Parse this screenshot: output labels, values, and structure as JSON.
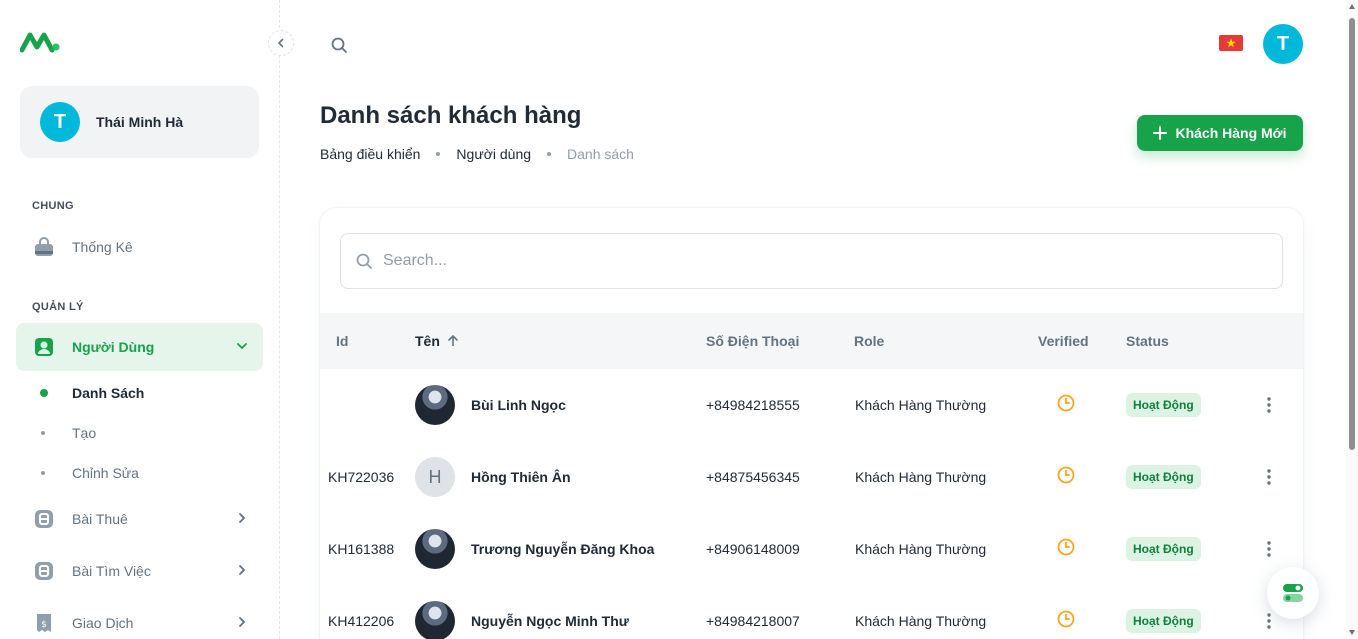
{
  "sidebar": {
    "user_initial": "T",
    "user_name": "Thái Minh Hà",
    "section_general": "CHUNG",
    "section_manage": "QUẢN LÝ",
    "items": [
      {
        "label": "Thống Kê",
        "icon": "bag-icon"
      },
      {
        "label": "Người Dùng",
        "icon": "user-icon"
      },
      {
        "label": "Bài Thuê",
        "icon": "blog-icon"
      },
      {
        "label": "Bài Tìm Việc",
        "icon": "blog-icon"
      },
      {
        "label": "Giao Dịch",
        "icon": "invoice-icon"
      }
    ],
    "sub_items": [
      {
        "label": "Danh Sách"
      },
      {
        "label": "Tạo"
      },
      {
        "label": "Chỉnh Sửa"
      }
    ]
  },
  "header": {
    "avatar_initial": "T",
    "language_flag": "vietnam-flag-icon"
  },
  "page": {
    "title": "Danh sách khách hàng",
    "breadcrumb": [
      "Bảng điều khiển",
      "Người dùng",
      "Danh sách"
    ],
    "new_button": "Khách Hàng Mới"
  },
  "search": {
    "placeholder": "Search..."
  },
  "table": {
    "columns": [
      "Id",
      "Tên",
      "Số Điện Thoại",
      "Role",
      "Verified",
      "Status"
    ],
    "rows": [
      {
        "id": "",
        "avatar": "photo",
        "initial": "",
        "name": "Bùi Linh Ngọc",
        "phone": "+84984218555",
        "role": "Khách Hàng Thường",
        "status": "Hoạt Động"
      },
      {
        "id": "KH722036",
        "avatar": "letter",
        "initial": "H",
        "name": "Hồng Thiên Ân",
        "phone": "+84875456345",
        "role": "Khách Hàng Thường",
        "status": "Hoạt Động"
      },
      {
        "id": "KH161388",
        "avatar": "photo",
        "initial": "",
        "name": "Trương Nguyễn Đăng Khoa",
        "phone": "+84906148009",
        "role": "Khách Hàng Thường",
        "status": "Hoạt Động"
      },
      {
        "id": "KH412206",
        "avatar": "photo",
        "initial": "",
        "name": "Nguyễn Ngọc Minh Thư",
        "phone": "+84984218007",
        "role": "Khách Hàng Thường",
        "status": "Hoạt Động"
      }
    ]
  },
  "colors": {
    "primary": "#16a34a",
    "avatar": "#00b8d9",
    "pending": "#f5a623"
  }
}
